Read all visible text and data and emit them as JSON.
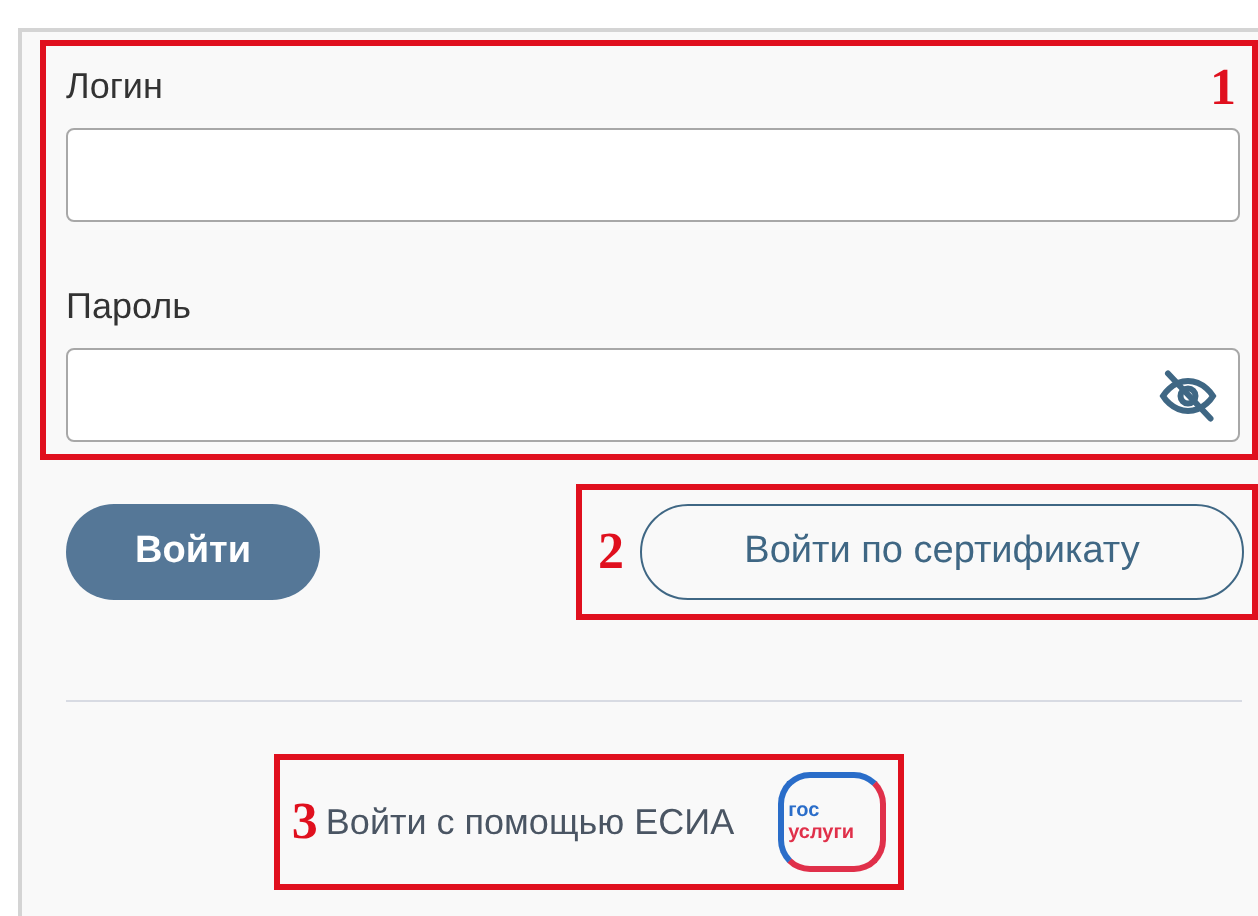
{
  "credentials": {
    "callout": "1",
    "fields": [
      {
        "label": "Логин",
        "kind": "text"
      },
      {
        "label": "Пароль",
        "kind": "password"
      }
    ]
  },
  "login_button": "Войти",
  "certificate": {
    "callout": "2",
    "button": "Войти по сертификату"
  },
  "esia": {
    "callout": "3",
    "link": "Войти с помощью ЕСИА",
    "logo": [
      "гос",
      "услуги"
    ]
  }
}
